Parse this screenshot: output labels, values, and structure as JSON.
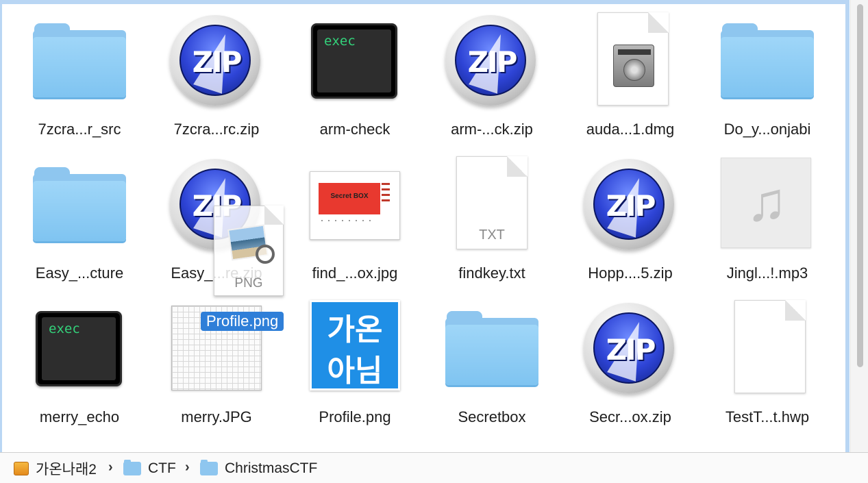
{
  "files": [
    {
      "label": "7zcra...r_src",
      "type": "folder"
    },
    {
      "label": "7zcra...rc.zip",
      "type": "zip"
    },
    {
      "label": "arm-check",
      "type": "exec"
    },
    {
      "label": "arm-...ck.zip",
      "type": "zip"
    },
    {
      "label": "auda...1.dmg",
      "type": "dmg"
    },
    {
      "label": "Do_y...onjabi",
      "type": "folder"
    },
    {
      "label": "Easy_...cture",
      "type": "folder"
    },
    {
      "label": "Easy_...re.zip",
      "type": "zip"
    },
    {
      "label": "find_...ox.jpg",
      "type": "image"
    },
    {
      "label": "findkey.txt",
      "type": "txt"
    },
    {
      "label": "Hopp....5.zip",
      "type": "zip"
    },
    {
      "label": "Jingl...!.mp3",
      "type": "audio"
    },
    {
      "label": "merry_echo",
      "type": "exec"
    },
    {
      "label": "merry.JPG",
      "type": "image"
    },
    {
      "label": "Profile.png",
      "type": "image"
    },
    {
      "label": "Secretbox",
      "type": "folder"
    },
    {
      "label": "Secr...ox.zip",
      "type": "zip"
    },
    {
      "label": "TestT...t.hwp",
      "type": "document"
    }
  ],
  "icon_text": {
    "zip": "ZIP",
    "exec": "exec",
    "txt": "TXT",
    "png": "PNG",
    "secret_box": "Secret BOX",
    "profile_line1": "가온",
    "profile_line2": "아님"
  },
  "drag": {
    "label": "Profile.png",
    "badge": "PNG"
  },
  "pathbar": {
    "items": [
      {
        "label": "가온나래2",
        "icon": "drive-icon"
      },
      {
        "label": "CTF",
        "icon": "folder-icon"
      },
      {
        "label": "ChristmasCTF",
        "icon": "folder-icon"
      }
    ],
    "separator": "›"
  },
  "colors": {
    "selection": "#2f7fd8",
    "folder": "#8ec6ef",
    "window_border": "#b9d6f4"
  }
}
